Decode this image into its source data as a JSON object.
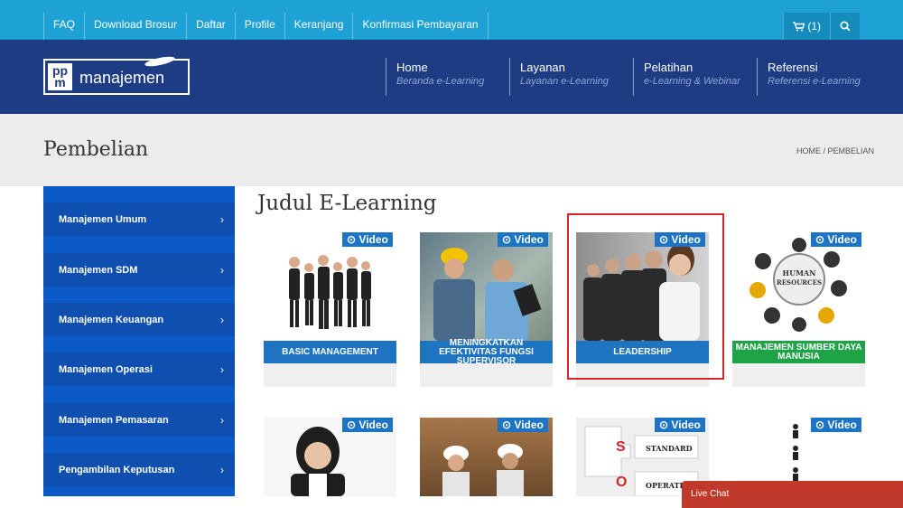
{
  "topbar": {
    "links": [
      "FAQ",
      "Download Brosur",
      "Daftar",
      "Profile",
      "Keranjang",
      "Konfirmasi Pembayaran"
    ],
    "cart_label": "(1)"
  },
  "header": {
    "logo_mark": "PP m",
    "logo_word": "manajemen",
    "nav": [
      {
        "title": "Home",
        "subtitle": "Beranda e-Learning"
      },
      {
        "title": "Layanan",
        "subtitle": "Layanan e-Learning"
      },
      {
        "title": "Pelatihan",
        "subtitle": "e-Learning & Webinar"
      },
      {
        "title": "Referensi",
        "subtitle": "Referensi e-Learning"
      }
    ]
  },
  "page": {
    "title": "Pembelian",
    "breadcrumb": "HOME / PEMBELIAN"
  },
  "sidebar": {
    "items": [
      "Manajemen Umum",
      "Manajemen SDM",
      "Manajemen Keuangan",
      "Manajemen Operasi",
      "Manajemen Pemasaran",
      "Pengambilan Keputusan"
    ]
  },
  "content": {
    "heading": "Judul E-Learning",
    "video_label": "Video",
    "cards": [
      {
        "title": "BASIC MANAGEMENT",
        "bar_color": "#1f74c2"
      },
      {
        "title": "MENINGKATKAN EFEKTIVITAS FUNGSI SUPERVISOR",
        "bar_color": "#1f74c2"
      },
      {
        "title": "LEADERSHIP",
        "bar_color": "#1f74c2"
      },
      {
        "title": "MANAJEMEN SUMBER DAYA MANUSIA",
        "bar_color": "#1ea447"
      }
    ],
    "puzzle_words": [
      "STANDARD",
      "OPERATING"
    ],
    "puzzle_letters": [
      "S",
      "O"
    ]
  },
  "livechat": {
    "label": "Live Chat"
  },
  "colors": {
    "accent": "#1ea2d5",
    "header": "#1e3c84",
    "sidebar": "#0a59c6",
    "highlight": "#d42626"
  }
}
